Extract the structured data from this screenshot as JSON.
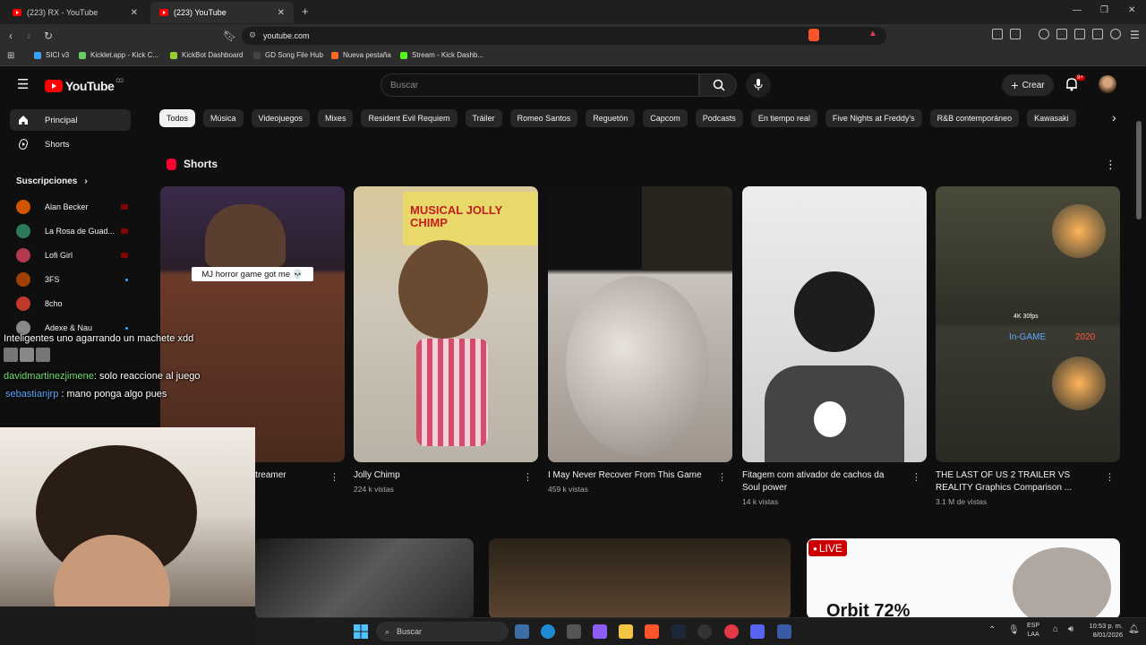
{
  "browser": {
    "tabs": [
      {
        "label": "(223) RX - YouTube"
      },
      {
        "label": "(223) YouTube"
      }
    ],
    "new_tab": "+",
    "url": "youtube.com",
    "bookmarks": [
      {
        "label": "SICI v3",
        "color": "#3aa0ff"
      },
      {
        "label": "Kicklet.app - Kick C...",
        "color": "#66cc66"
      },
      {
        "label": "KickBot Dashboard",
        "color": "#9acd32"
      },
      {
        "label": "GD Song File Hub",
        "color": "#444444"
      },
      {
        "label": "Nueva pestaña",
        "color": "#ff6a2a"
      },
      {
        "label": "Stream - Kick Dashb...",
        "color": "#53fc18"
      }
    ]
  },
  "youtube": {
    "logo_text": "YouTube",
    "logo_region": "CO",
    "search_placeholder": "Buscar",
    "create_label": "Crear",
    "notifications": "9+",
    "sidebar": {
      "items": [
        {
          "label": "Principal",
          "icon": "home-icon"
        },
        {
          "label": "Shorts",
          "icon": "shorts-icon"
        }
      ],
      "subscriptions_title": "Suscripciones",
      "subscriptions": [
        {
          "name": "Alan Becker",
          "color": "#d35400"
        },
        {
          "name": "La Rosa de Guad...",
          "color": "#2c7a5a"
        },
        {
          "name": "Lofi Girl",
          "color": "#b33951"
        },
        {
          "name": "3FS",
          "color": "#a04000"
        },
        {
          "name": "8cho",
          "color": "#c0392b"
        },
        {
          "name": "Adexe & Nau",
          "color": "#888888"
        }
      ]
    },
    "chips": [
      "Todos",
      "Música",
      "Videojuegos",
      "Mixes",
      "Resident Evil Requiem",
      "Tráiler",
      "Romeo Santos",
      "Reguetón",
      "Capcom",
      "Podcasts",
      "En tiempo real",
      "Five Nights at Freddy's",
      "R&B contemporáneo",
      "Kawasaki"
    ],
    "shorts_title": "Shorts",
    "shorts": [
      {
        "title": "...gaming #horror ...e #streamer",
        "views": "",
        "overlay": "MJ horror game got me 💀"
      },
      {
        "title": "Jolly Chimp",
        "views": "224 k vistas",
        "overlay": ""
      },
      {
        "title": "I May Never Recover From This Game",
        "views": "459 k vistas",
        "overlay": ""
      },
      {
        "title": "Fitagem com ativador de cachos da Soul power",
        "views": "14 k vistas",
        "overlay": ""
      },
      {
        "title": "THE LAST OF US 2 TRAILER VS REALITY Graphics Comparison ...",
        "views": "3.1 M de vistas",
        "overlay": "In-GAME"
      }
    ],
    "short5_year": "2020",
    "short5_spec": "4K 30fps",
    "chimp_box_text": "MUSICAL JOLLY CHIMP",
    "live_badge": "LIVE",
    "live_video_title": "Orbit 72%"
  },
  "chat": [
    {
      "user": "",
      "message": "Inteligentes uno agarrando un machete xdd"
    },
    {
      "user": "davidmartinezjimene",
      "message": ": solo reaccione al juego"
    },
    {
      "user": "sebastianjrp",
      "message": ": mano ponga algo pues"
    }
  ],
  "taskbar": {
    "search_label": "Buscar",
    "lang": "ESP",
    "lang2": "LAA",
    "time": "10:53 p. m.",
    "date": "8/01/2026"
  }
}
